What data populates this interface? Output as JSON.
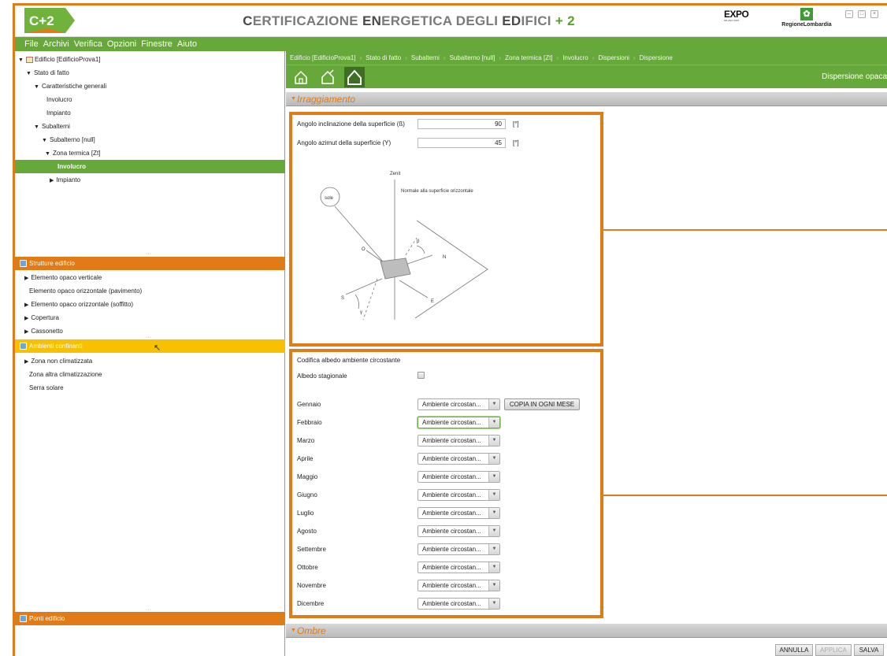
{
  "app": {
    "logo_text": "C+2",
    "title_parts": [
      "C",
      "ERTIFICAZIONE ",
      "EN",
      "ERGETICA DEGLI ",
      "ED",
      "IFICI",
      " + 2"
    ],
    "expo_text": "EXPO",
    "expo_sub": "MILANO 2015",
    "region_text": "RegioneLombardia"
  },
  "menu": [
    "File",
    "Archivi",
    "Verifica",
    "Opzioni",
    "Finestre",
    "Aiuto"
  ],
  "tree": {
    "root": "Edificio [EdificioProva1]",
    "stato": "Stato di fatto",
    "caratteristiche": "Caratteristiche generali",
    "involucro": "Involucro",
    "impianto": "Impianto",
    "subalterni": "Subalterni",
    "subalterno": "Subalterno [null]",
    "zona": "Zona termica [Zt]",
    "zona_involucro": "Involucro",
    "zona_impianto": "Impianto"
  },
  "strutture": {
    "title": "Strutture edificio",
    "items": [
      "Elemento opaco verticale",
      "Elemento opaco orizzontale (pavimento)",
      "Elemento opaco orizzontale (soffitto)",
      "Copertura",
      "Cassonetto"
    ]
  },
  "ambienti": {
    "title": "Ambienti confinanti",
    "items": [
      "Zona non climatizzata",
      "Zona altra climatizzazione",
      "Serra solare"
    ]
  },
  "ponti": {
    "title": "Ponti edificio"
  },
  "breadcrumb": [
    "Edificio [EdificioProva1]",
    "Stato di fatto",
    "Subalterni",
    "Subalterno [null]",
    "Zona termica [Zt]",
    "Involucro",
    "Dispersioni",
    "Dispersione"
  ],
  "toolbar": {
    "title": "Dispersione opaca"
  },
  "irraggiamento": {
    "title": "Irraggiamento",
    "incl_label": "Angolo inclinazione della superficie (ß)",
    "incl_value": "90",
    "incl_unit": "[°]",
    "azim_label": "Angolo azimut della superficie (Y)",
    "azim_value": "45",
    "azim_unit": "[°]",
    "diagram": {
      "zenit": "Zenit",
      "sole": "sole",
      "normale": "Normale alla superficie orizzontale",
      "o": "O",
      "n": "N",
      "s": "S",
      "e": "E",
      "beta": "β",
      "gamma": "γ"
    }
  },
  "albedo": {
    "title": "Codifica albedo ambiente circostante",
    "stagionale_label": "Albedo stagionale",
    "copy_button": "COPIA IN OGNI MESE",
    "months": [
      {
        "name": "Gennaio",
        "value": "Ambiente circostan..."
      },
      {
        "name": "Febbraio",
        "value": "Ambiente circostan..."
      },
      {
        "name": "Marzo",
        "value": "Ambiente circostan..."
      },
      {
        "name": "Aprile",
        "value": "Ambiente circostan..."
      },
      {
        "name": "Maggio",
        "value": "Ambiente circostan..."
      },
      {
        "name": "Giugno",
        "value": "Ambiente circostan..."
      },
      {
        "name": "Luglio",
        "value": "Ambiente circostan..."
      },
      {
        "name": "Agosto",
        "value": "Ambiente circostan..."
      },
      {
        "name": "Settembre",
        "value": "Ambiente circostan..."
      },
      {
        "name": "Ottobre",
        "value": "Ambiente circostan..."
      },
      {
        "name": "Novembre",
        "value": "Ambiente circostan..."
      },
      {
        "name": "Dicembre",
        "value": "Ambiente circostan..."
      }
    ]
  },
  "ombre": {
    "title": "Ombre"
  },
  "footer": {
    "annulla": "ANNULLA",
    "applica": "APPLICA",
    "salva": "SALVA"
  },
  "colors": {
    "accent": "#e07b18",
    "green": "#67a83a",
    "yellow": "#f7c000"
  }
}
